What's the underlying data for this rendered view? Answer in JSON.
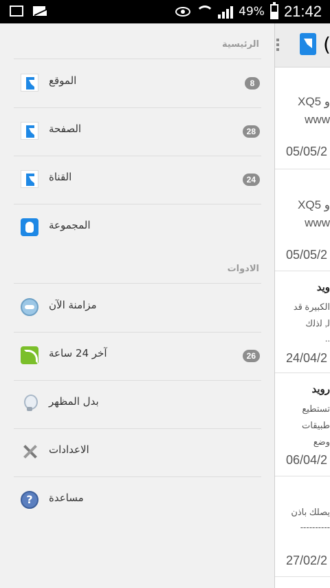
{
  "statusbar": {
    "battery": "49%",
    "time": "21:42"
  },
  "drawer": {
    "sections": {
      "main": "الرئيسية",
      "tools": "الادوات"
    },
    "items": [
      {
        "label": "الموقع",
        "badge": "8",
        "icon": "page-logo-icon"
      },
      {
        "label": "الصفحة",
        "badge": "28",
        "icon": "page-logo-icon"
      },
      {
        "label": "القناة",
        "badge": "24",
        "icon": "page-logo-icon"
      },
      {
        "label": "المجموعة",
        "badge": "",
        "icon": "group-icon"
      },
      {
        "label": "مزامنة الآن",
        "badge": "",
        "icon": "sync-icon"
      },
      {
        "label": "آخر 24 ساعة",
        "badge": "26",
        "icon": "rss-icon"
      },
      {
        "label": "بدل المظهر",
        "badge": "",
        "icon": "bulb-icon"
      },
      {
        "label": "الاعدادات",
        "badge": "",
        "icon": "tools-icon"
      },
      {
        "label": "مساعدة",
        "badge": "",
        "icon": "help-icon"
      }
    ]
  },
  "background_list": {
    "header_paren": "(",
    "cells": [
      {
        "line1": "XQ5 و",
        "line2": "www",
        "date": "05/05/2"
      },
      {
        "line1": "XQ5 و",
        "line2": "www",
        "date": "05/05/2"
      },
      {
        "line1": "ويد",
        "line2": "الكبيرة قد",
        "line3": "ﻟ, ﻟذﻟك",
        "line4": "..",
        "date": "24/04/2"
      },
      {
        "line1": "روید",
        "line2": "تستطيع",
        "line3": "طبيقات",
        "line4": "وضع",
        "date": "06/04/2"
      },
      {
        "line1": "يصلك باذن",
        "line2": "----------",
        "date": "27/02/2"
      }
    ]
  },
  "help_glyph": "?"
}
